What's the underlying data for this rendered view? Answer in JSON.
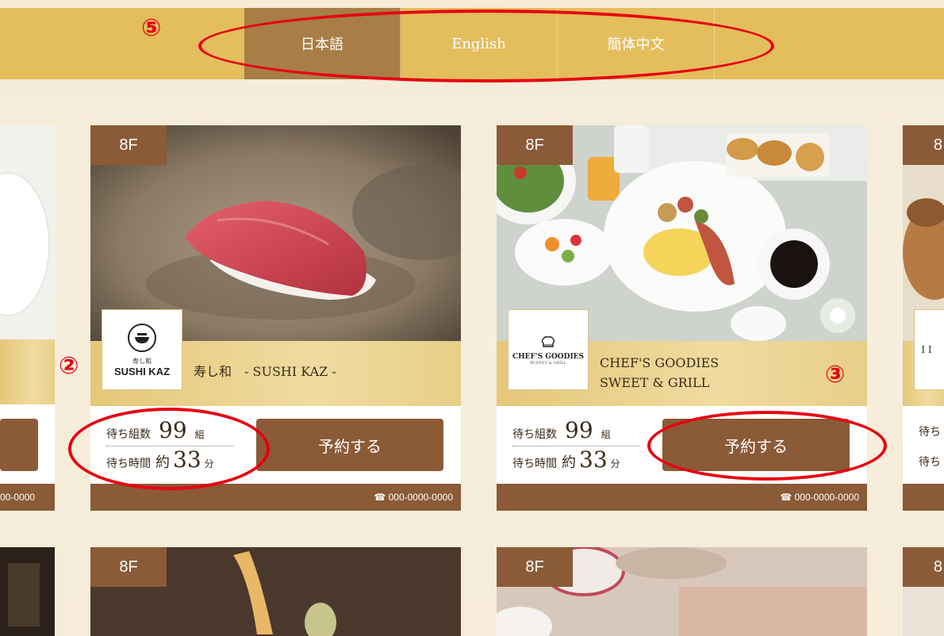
{
  "annotations": {
    "lang": "⑤",
    "wait": "②",
    "reserve": "③"
  },
  "languages": [
    {
      "label": "日本語",
      "active": true
    },
    {
      "label": "English",
      "active": false
    },
    {
      "label": "簡体中文",
      "active": false
    }
  ],
  "cards": [
    {
      "floor": "8F",
      "logo_small": "寿し和",
      "logo_main": "SUSHI KAZ",
      "name_line1": "寿し和　- SUSHI KAZ -",
      "name_line2": "",
      "wait_groups_label": "待ち組数",
      "wait_groups_value": "99",
      "wait_groups_unit": "組",
      "wait_time_label": "待ち時間",
      "wait_time_prefix": "約",
      "wait_time_value": "33",
      "wait_time_unit": "分",
      "reserve_label": "予約する",
      "phone": "☎ 000-0000-0000"
    },
    {
      "floor": "8F",
      "logo_main": "CHEF'S GOODIES",
      "logo_small": "BUFFET & GRILL",
      "name_line1": "CHEF'S GOODIES",
      "name_line2": "SWEET & GRILL",
      "wait_groups_label": "待ち組数",
      "wait_groups_value": "99",
      "wait_groups_unit": "組",
      "wait_time_label": "待ち時間",
      "wait_time_prefix": "約",
      "wait_time_value": "33",
      "wait_time_unit": "分",
      "reserve_label": "予約する",
      "phone": "☎ 000-0000-0000"
    }
  ],
  "partial": {
    "left_phone": "00-0000",
    "right_floor": "8",
    "right_wait1": "待ち",
    "right_wait2": "待ち",
    "right_logo_text": "I I"
  },
  "row2_floors": [
    "8F",
    "8F",
    "8"
  ]
}
